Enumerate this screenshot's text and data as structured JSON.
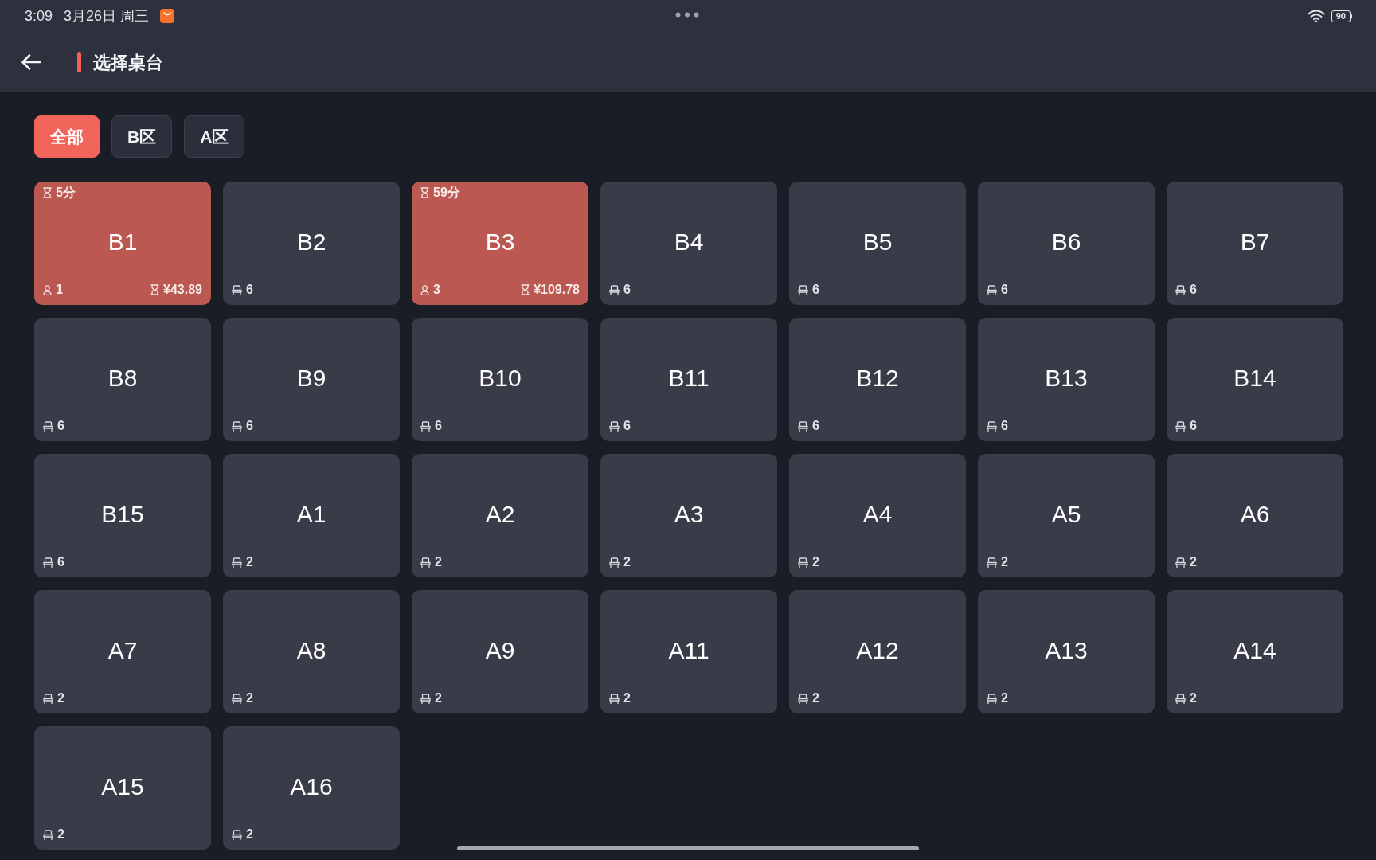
{
  "status_bar": {
    "time": "3:09",
    "date": "3月26日 周三",
    "battery": "90"
  },
  "header": {
    "title": "选择桌台"
  },
  "tabs": [
    {
      "label": "全部",
      "selected": true
    },
    {
      "label": "B区",
      "selected": false
    },
    {
      "label": "A区",
      "selected": false
    }
  ],
  "tables": [
    {
      "name": "B1",
      "kind": "occupied",
      "timer": "5分",
      "guests": "1",
      "amount": "¥43.89"
    },
    {
      "name": "B2",
      "kind": "free",
      "seats": "6"
    },
    {
      "name": "B3",
      "kind": "occupied",
      "timer": "59分",
      "guests": "3",
      "amount": "¥109.78"
    },
    {
      "name": "B4",
      "kind": "free",
      "seats": "6"
    },
    {
      "name": "B5",
      "kind": "free",
      "seats": "6"
    },
    {
      "name": "B6",
      "kind": "free",
      "seats": "6"
    },
    {
      "name": "B7",
      "kind": "free",
      "seats": "6"
    },
    {
      "name": "B8",
      "kind": "free",
      "seats": "6"
    },
    {
      "name": "B9",
      "kind": "free",
      "seats": "6"
    },
    {
      "name": "B10",
      "kind": "free",
      "seats": "6"
    },
    {
      "name": "B11",
      "kind": "free",
      "seats": "6"
    },
    {
      "name": "B12",
      "kind": "free",
      "seats": "6"
    },
    {
      "name": "B13",
      "kind": "free",
      "seats": "6"
    },
    {
      "name": "B14",
      "kind": "free",
      "seats": "6"
    },
    {
      "name": "B15",
      "kind": "free",
      "seats": "6"
    },
    {
      "name": "A1",
      "kind": "free",
      "seats": "2"
    },
    {
      "name": "A2",
      "kind": "free",
      "seats": "2"
    },
    {
      "name": "A3",
      "kind": "free",
      "seats": "2"
    },
    {
      "name": "A4",
      "kind": "free",
      "seats": "2"
    },
    {
      "name": "A5",
      "kind": "free",
      "seats": "2"
    },
    {
      "name": "A6",
      "kind": "free",
      "seats": "2"
    },
    {
      "name": "A7",
      "kind": "free",
      "seats": "2"
    },
    {
      "name": "A8",
      "kind": "free",
      "seats": "2"
    },
    {
      "name": "A9",
      "kind": "free",
      "seats": "2"
    },
    {
      "name": "A11",
      "kind": "free",
      "seats": "2"
    },
    {
      "name": "A12",
      "kind": "free",
      "seats": "2"
    },
    {
      "name": "A13",
      "kind": "free",
      "seats": "2"
    },
    {
      "name": "A14",
      "kind": "free",
      "seats": "2"
    },
    {
      "name": "A15",
      "kind": "free",
      "seats": "2"
    },
    {
      "name": "A16",
      "kind": "free",
      "seats": "2"
    }
  ]
}
